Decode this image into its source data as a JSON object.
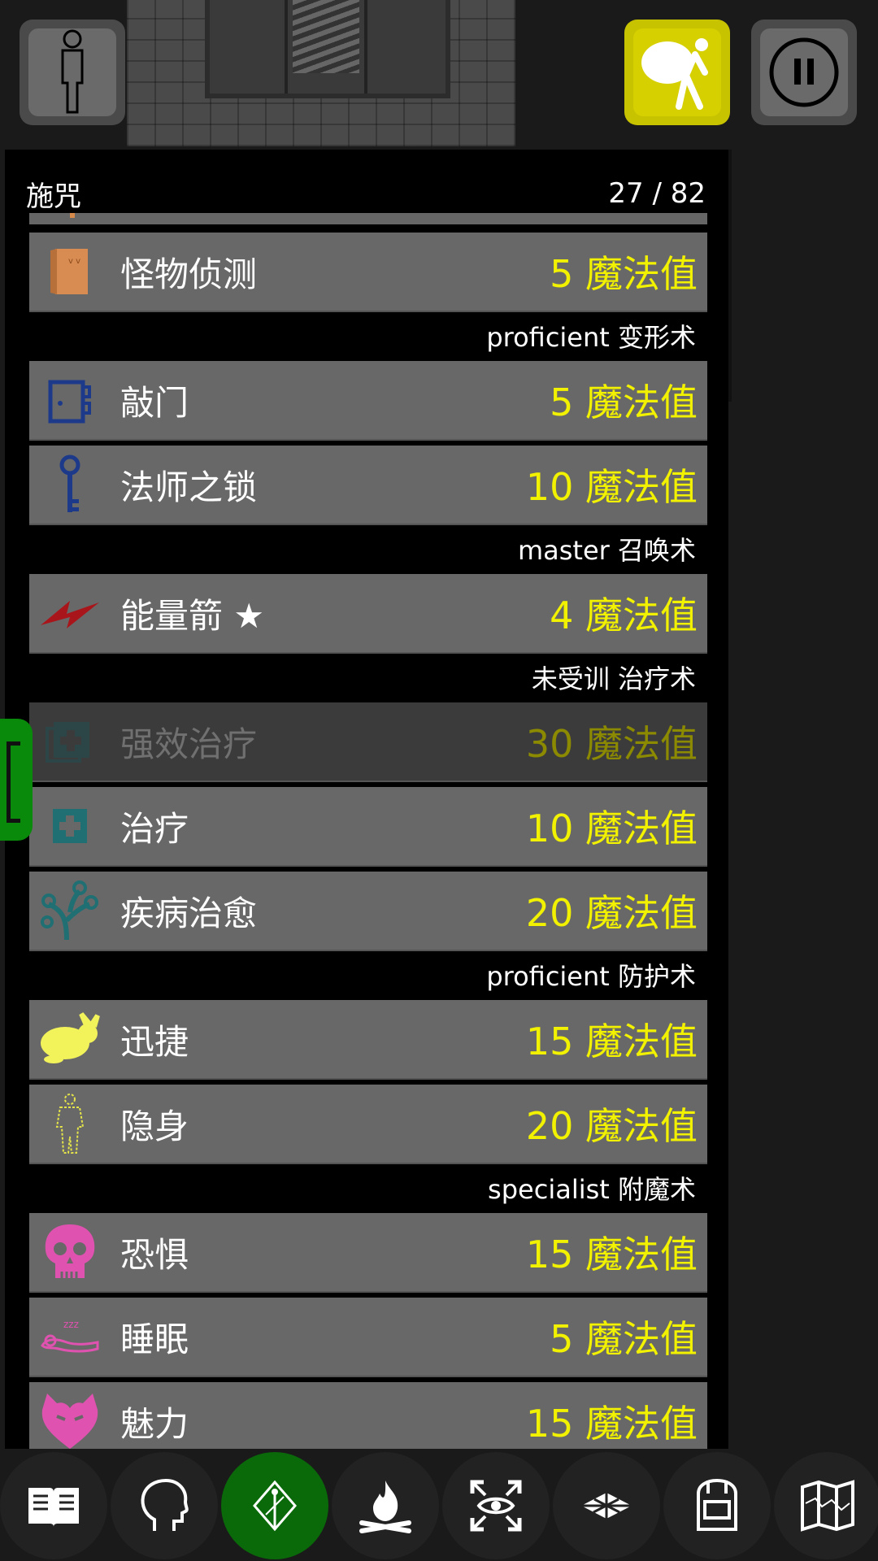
{
  "panel": {
    "title": "施咒",
    "count": "27 / 82"
  },
  "colors": {
    "cost_text": "#f2f200",
    "active_nav": "#0a6a0a",
    "inventory_button": "#d6d000"
  },
  "schools": {
    "transmutation": "proficient 变形术",
    "conjuration": "master 召唤术",
    "healing": "未受训 治疗术",
    "protection": "proficient 防护术",
    "enchantment": "specialist 附魔术"
  },
  "spells": [
    {
      "icon": "door-icon",
      "name": "怪物侦测",
      "cost": "5 魔法值"
    },
    {
      "icon": "knock-door-icon",
      "name": "敲门",
      "cost": "5 魔法值"
    },
    {
      "icon": "key-icon",
      "name": "法师之锁",
      "cost": "10 魔法值"
    },
    {
      "icon": "lightning-icon",
      "name": "能量箭 ★",
      "cost": "4 魔法值"
    },
    {
      "icon": "greater-heal-icon",
      "name": "强效治疗",
      "cost": "30 魔法值"
    },
    {
      "icon": "heal-icon",
      "name": "治疗",
      "cost": "10 魔法值"
    },
    {
      "icon": "cure-disease-icon",
      "name": "疾病治愈",
      "cost": "20 魔法值"
    },
    {
      "icon": "rabbit-icon",
      "name": "迅捷",
      "cost": "15 魔法值"
    },
    {
      "icon": "invisible-person-icon",
      "name": "隐身",
      "cost": "20 魔法值"
    },
    {
      "icon": "skull-icon",
      "name": "恐惧",
      "cost": "15 魔法值"
    },
    {
      "icon": "sleep-icon",
      "name": "睡眠",
      "cost": "5 魔法值"
    },
    {
      "icon": "heart-icon",
      "name": "魅力",
      "cost": "15 魔法值"
    }
  ],
  "top_buttons": [
    "person-icon",
    "sack-carrier-icon",
    "pause-icon"
  ],
  "bottom_nav": [
    "book-icon",
    "head-icon",
    "spell-staff-icon",
    "campfire-icon",
    "look-icon",
    "floor-tiles-icon",
    "backpack-icon",
    "map-icon"
  ]
}
